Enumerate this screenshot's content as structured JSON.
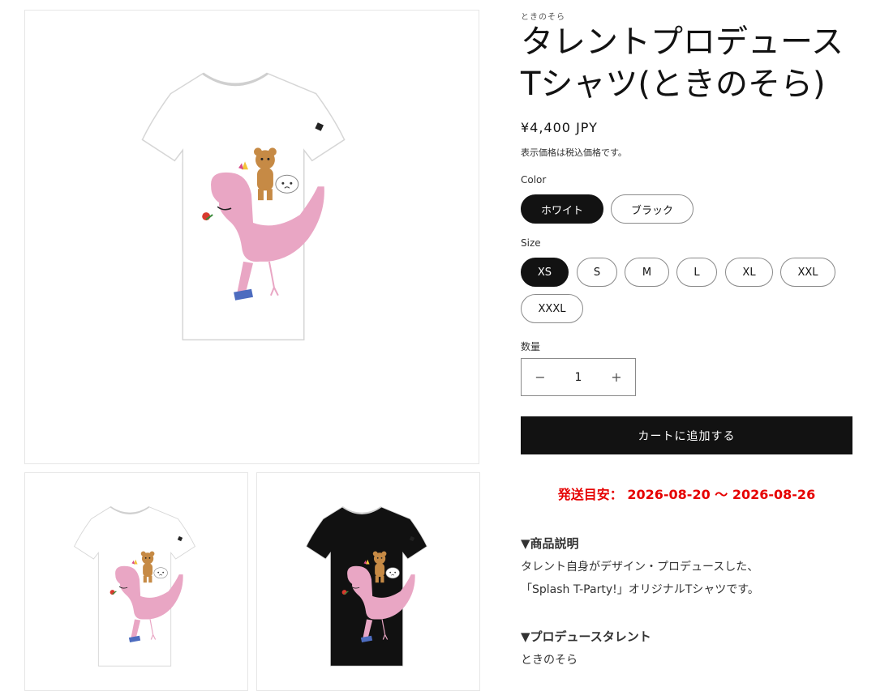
{
  "product": {
    "vendor": "ときのそら",
    "title_line1": "タレントプロデュース",
    "title_line2": "Tシャツ(ときのそら)",
    "price": "¥4,400 JPY",
    "tax_note": "表示価格は税込価格です。"
  },
  "color_option": {
    "label": "Color",
    "values": [
      "ホワイト",
      "ブラック"
    ],
    "selected": "ホワイト"
  },
  "size_option": {
    "label": "Size",
    "values": [
      "XS",
      "S",
      "M",
      "L",
      "XL",
      "XXL",
      "XXXL"
    ],
    "selected": "XS"
  },
  "quantity": {
    "label": "数量",
    "minus": "−",
    "value": "1",
    "plus": "+"
  },
  "cart_button": "カートに追加する",
  "shipping": "発送目安： 2026-08-20 〜 2026-08-26",
  "description": {
    "heading": "▼商品説明",
    "line1": "タレント自身がデザイン・プロデュースした、",
    "line2": "「Splash T-Party!」オリジナルTシャツです。"
  },
  "talent": {
    "heading": "▼プロデュースタレント",
    "name": "ときのそら"
  },
  "colors": {
    "white_shirt": "#ffffff",
    "black_shirt": "#111111",
    "dino_pink": "#e9a6c4",
    "bear_brown": "#c68a45",
    "boot_blue": "#4d6cbf",
    "shipping_red": "#e60000"
  }
}
